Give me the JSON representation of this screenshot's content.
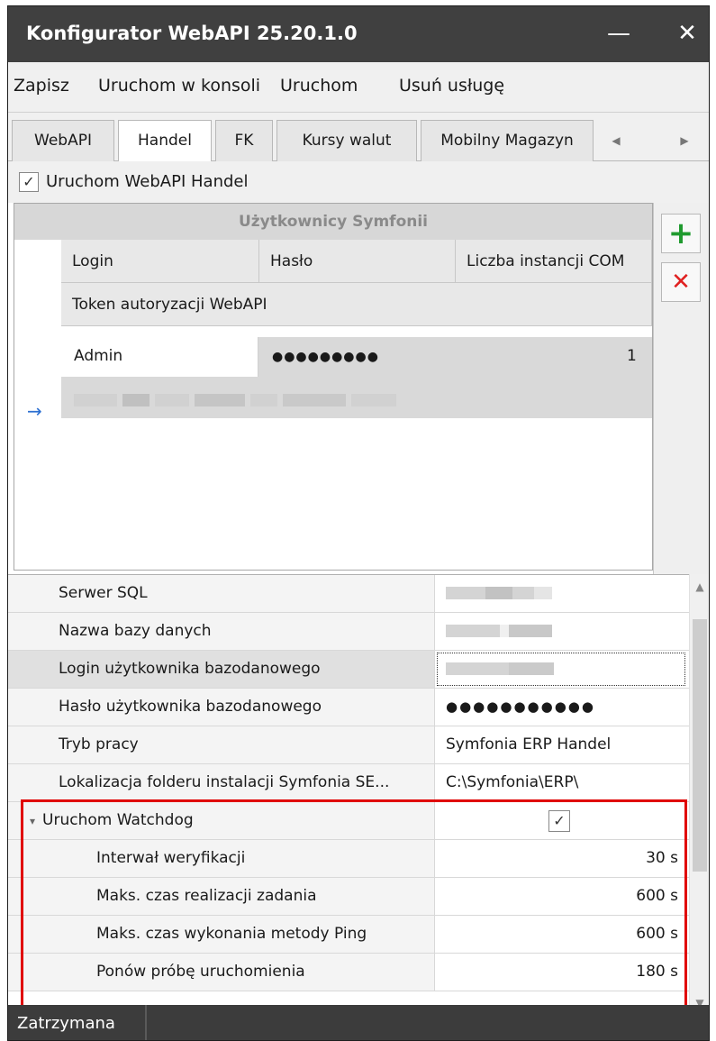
{
  "window": {
    "title": "Konfigurator WebAPI 25.20.1.0",
    "minimize_glyph": "—",
    "close_glyph": "✕"
  },
  "menu": {
    "items": [
      "Zapisz",
      "Uruchom w konsoli",
      "Uruchom",
      "Usuń usługę"
    ]
  },
  "tabs": {
    "items": [
      "WebAPI",
      "Handel",
      "FK",
      "Kursy walut",
      "Mobilny Magazyn"
    ],
    "active": "Handel",
    "left_arrow": "◀",
    "right_arrow": "▶"
  },
  "run_handel": {
    "label": "Uruchom WebAPI Handel",
    "checked": true,
    "check_glyph": "✓"
  },
  "users_grid": {
    "caption": "Użytkownicy Symfonii",
    "columns": [
      "Login",
      "Hasło",
      "Liczba instancji COM"
    ],
    "token_column": "Token autoryzacji WebAPI",
    "current_row_glyph": "→",
    "rows": [
      {
        "login": "Admin",
        "password": "●●●●●●●●●",
        "com_instances": "1"
      }
    ],
    "add_glyph": "+",
    "delete_glyph": "✕"
  },
  "properties": {
    "rows": [
      {
        "name": "Serwer SQL",
        "value": ""
      },
      {
        "name": "Nazwa bazy danych",
        "value": ""
      },
      {
        "name": "Login użytkownika bazodanowego",
        "value": ""
      },
      {
        "name": "Hasło użytkownika bazodanowego",
        "value": "●●●●●●●●●●●"
      },
      {
        "name": "Tryb pracy",
        "value": "Symfonia ERP Handel"
      },
      {
        "name": "Lokalizacja folderu instalacji Symfonia SE...",
        "value": "C:\\Symfonia\\ERP\\"
      },
      {
        "name": "Uruchom Watchdog",
        "value": "✓",
        "expand_glyph": "▾"
      },
      {
        "name": "Interwał weryfikacji",
        "value": "30 s"
      },
      {
        "name": "Maks. czas realizacji zadania",
        "value": "600 s"
      },
      {
        "name": "Maks. czas wykonania metody Ping",
        "value": "600 s"
      },
      {
        "name": "Ponów próbę uruchomienia",
        "value": "180 s"
      }
    ],
    "scroll_up": "▲",
    "scroll_down": "▼"
  },
  "status": {
    "text": "Zatrzymana"
  },
  "colors": {
    "titlebar": "#404040",
    "add_button": "#1f9a2e",
    "delete_button": "#e02020",
    "highlight_frame": "#e00000"
  }
}
